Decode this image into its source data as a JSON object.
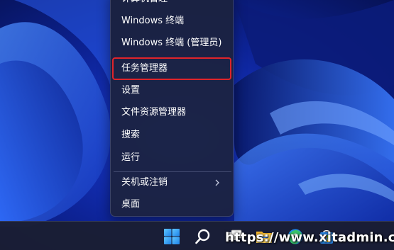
{
  "menu": {
    "items": [
      {
        "label": "计算机管理",
        "partial": true
      },
      {
        "label": "Windows 终端"
      },
      {
        "label": "Windows 终端 (管理员)"
      },
      {
        "label": "任务管理器",
        "highlighted": true
      },
      {
        "label": "设置"
      },
      {
        "label": "文件资源管理器"
      },
      {
        "label": "搜索"
      },
      {
        "label": "运行"
      },
      {
        "label": "关机或注销",
        "has_submenu": true
      },
      {
        "label": "桌面"
      }
    ],
    "highlight_color": "#e0242a"
  },
  "taskbar": {
    "icons": [
      "start-icon",
      "search-icon",
      "task-view-icon",
      "file-explorer-icon",
      "edge-icon",
      "store-icon"
    ]
  },
  "watermark": {
    "text": "https://www.xitadmin.cc"
  },
  "colors": {
    "menu_bg": "#1c223e",
    "wallpaper_base": "#0a1a6e",
    "wallpaper_accent": "#2e6cff",
    "taskbar_bg": "#1a1e34"
  }
}
